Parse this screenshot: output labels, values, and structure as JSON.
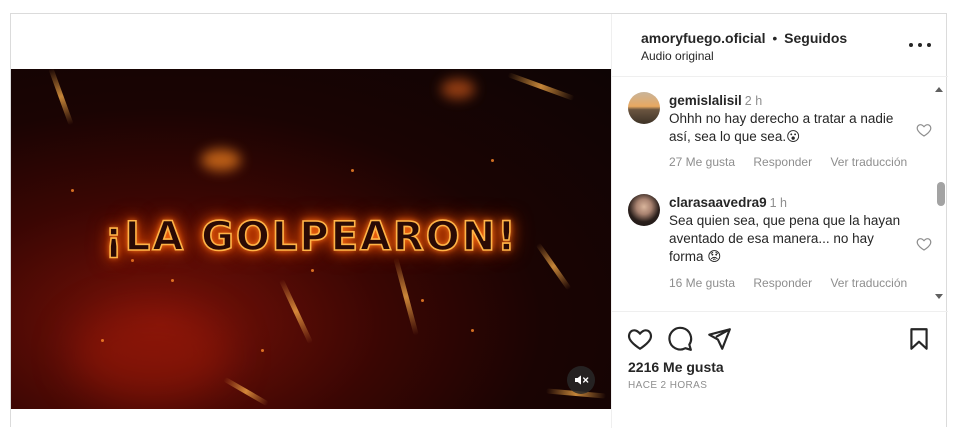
{
  "video": {
    "headline": "¡LA GOLPEARON!",
    "mute_icon": "speaker-muted-icon"
  },
  "header": {
    "owner": "amoryfuego.oficial",
    "separator": "•",
    "follow_state": "Seguidos",
    "audio": "Audio original",
    "more_icon": "more-options-icon"
  },
  "comments": [
    {
      "user": "gemislalisil",
      "time": "2 h",
      "text": "Ohhh no hay derecho a tratar a nadie así, sea lo que sea.😮",
      "likes": "27 Me gusta",
      "reply": "Responder",
      "translate": "Ver traducción"
    },
    {
      "user": "clarasaavedra9",
      "time": "1 h",
      "text": "Sea quien sea, que pena que la hayan aventado de esa manera... no hay forma 😟",
      "likes": "16 Me gusta",
      "reply": "Responder",
      "translate": "Ver traducción"
    }
  ],
  "actions": {
    "likes": "2216 Me gusta",
    "time_ago": "HACE 2 HORAS",
    "icons": [
      "heart-icon",
      "comment-icon",
      "share-icon",
      "bookmark-icon"
    ]
  },
  "colors": {
    "text": "#262626",
    "muted": "#8e8e8e",
    "border": "#dbdbdb",
    "fire": "#ff7b1c"
  }
}
